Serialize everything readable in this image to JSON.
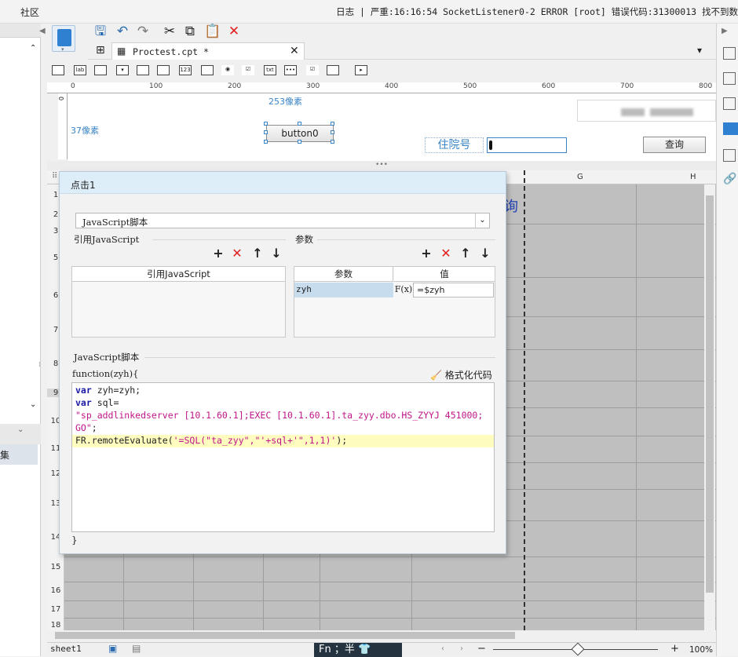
{
  "topbar": {
    "community": "社区",
    "status": "日志 | 严重:16:16:54 SocketListener0-2 ERROR [root] 错误代码:31300013 找不到数"
  },
  "left_panel": {
    "dataset_label": "集"
  },
  "tab": {
    "title": "Proctest.cpt *",
    "close": "✕"
  },
  "ruler": {
    "ticks": [
      "0",
      "100",
      "200",
      "300",
      "400",
      "500",
      "600",
      "700",
      "800"
    ],
    "v_tick": "0"
  },
  "canvas": {
    "label_top": "253像素",
    "label_left": "37像素",
    "button0": "button0",
    "zyh_label": "住院号",
    "query_button": "查询"
  },
  "grid": {
    "columns": [
      "G",
      "H"
    ],
    "rows": [
      "1",
      "2",
      "3",
      "5",
      "6",
      "7",
      "8",
      "9",
      "10",
      "11",
      "12",
      "13",
      "14",
      "15",
      "16",
      "17",
      "18"
    ],
    "blue_char": "询"
  },
  "bottom": {
    "sheet": "sheet1",
    "ime": "Fn ；半 👕",
    "zoom_minus": "−",
    "zoom_plus": "+",
    "zoom": "100%"
  },
  "dialog": {
    "title": "点击1",
    "type_select": "JavaScript脚本",
    "ref_section": "引用JavaScript",
    "ref_col": "引用JavaScript",
    "param_section": "参数",
    "param_col_name": "参数",
    "param_col_value": "值",
    "param": {
      "name": "zyh",
      "fx": "F(x)",
      "value": "=$zyh"
    },
    "script_section": "JavaScript脚本",
    "fn_signature": "function(zyh){",
    "format_button": "格式化代码",
    "fn_close": "}",
    "code": {
      "line1_kw": "var",
      "line1_rest": " zyh=zyh;",
      "line2_kw": "var",
      "line2_rest": " sql=",
      "line3": "\"sp_addlinkedserver [10.1.60.1];EXEC [10.1.60.1].ta_zyy.dbo.HS_ZYYJ 451000;",
      "line4_str": "GO\"",
      "line4_rest": ";",
      "line5_a": "FR.remoteEvaluate(",
      "line5_str": "'=SQL(\"ta_zyy\",\"'+sql+'\",1,1)'",
      "line5_b": ");"
    }
  },
  "colors": {
    "accent": "#3a84c6",
    "dialog_title_bg": "#ddeef9",
    "keyword": "#1a1aa6",
    "string": "#c0158a"
  }
}
